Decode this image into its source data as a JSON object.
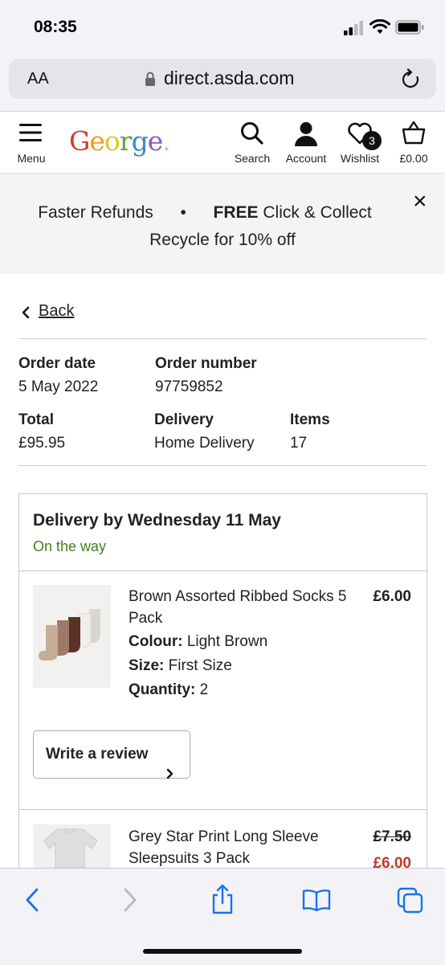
{
  "status_bar": {
    "time": "08:35"
  },
  "browser": {
    "text_size_label": "AA",
    "url": "direct.asda.com"
  },
  "header": {
    "menu_label": "Menu",
    "logo": "George.",
    "search_label": "Search",
    "account_label": "Account",
    "wishlist_label": "Wishlist",
    "wishlist_count": "3",
    "basket_label": "£0.00"
  },
  "promo": {
    "left": "Faster Refunds",
    "bullet": "•",
    "free": "FREE",
    "collect": "Click & Collect",
    "line2": "Recycle for 10% off",
    "close": "×"
  },
  "back_label": "Back",
  "order": {
    "date_label": "Order date",
    "date_value": "5 May 2022",
    "number_label": "Order number",
    "number_value": "97759852",
    "total_label": "Total",
    "total_value": "£95.95",
    "delivery_label": "Delivery",
    "delivery_value": "Home Delivery",
    "items_label": "Items",
    "items_value": "17"
  },
  "delivery_group": {
    "title": "Delivery by Wednesday 11 May",
    "status": "On the way",
    "items": [
      {
        "name": "Brown Assorted Ribbed Socks 5 Pack",
        "price": "£6.00",
        "colour_label": "Colour:",
        "colour_value": "Light Brown",
        "size_label": "Size:",
        "size_value": "First Size",
        "quantity_label": "Quantity:",
        "quantity_value": "2",
        "review_label": "Write a review"
      },
      {
        "name": "Grey Star Print Long Sleeve Sleepsuits 3 Pack",
        "original_price": "£7.50",
        "sale_price": "£6.00"
      }
    ]
  },
  "colors": {
    "status_green": "#3f7f1f",
    "sale_red": "#c0392b",
    "ios_blue": "#1a73e8"
  },
  "toolbar_icons": [
    "back-arrow-icon",
    "forward-arrow-icon",
    "share-icon",
    "bookmarks-icon",
    "tabs-icon"
  ]
}
